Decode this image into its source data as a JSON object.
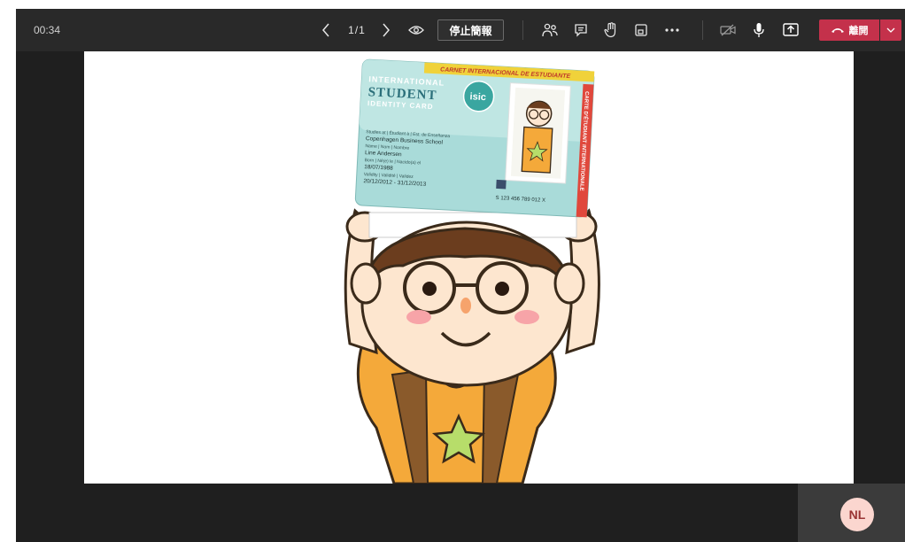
{
  "meeting": {
    "timer": "00:34",
    "page_indicator": "1/1",
    "stop_presenting_label": "停止簡報",
    "leave_label": "離開"
  },
  "toolbar": {
    "icons": [
      "chevron-left-icon",
      "chevron-right-icon",
      "eye-icon",
      "people-icon",
      "chat-icon",
      "raise-hand-icon",
      "rooms-icon",
      "more-icon",
      "camera-off-icon",
      "mic-icon",
      "share-tray-icon",
      "phone-icon",
      "chevron-down-icon"
    ]
  },
  "slide": {
    "card": {
      "banner": "CARNET INTERNACIONAL DE ESTUDIANTE",
      "side_text": "CARTE D'ÉTUDIANT INTERNATIONALE",
      "title_line1": "INTERNATIONAL",
      "title_line2": "STUDENT",
      "title_line3": "IDENTITY CARD",
      "logo": "isic",
      "studies_label": "Studies at | Étudiant à | Est. de Enseñanza",
      "school": "Copenhagen Business School",
      "name_label": "Name | Nom | Nombre",
      "name": "Line Andersen",
      "born_label": "Born | Né(e) le | Nacido(a) el",
      "born": "18/07/1988",
      "validity_label": "Validity | Validité | Validez",
      "validity": "20/12/2012 - 31/12/2013",
      "card_number": "S 123 456 789 012 X"
    }
  },
  "self_view": {
    "initials": "NL"
  },
  "colors": {
    "leave": "#c4314b",
    "topbar": "#292929",
    "background": "#1f1f1f",
    "avatar_bg": "#fbd6cf"
  }
}
